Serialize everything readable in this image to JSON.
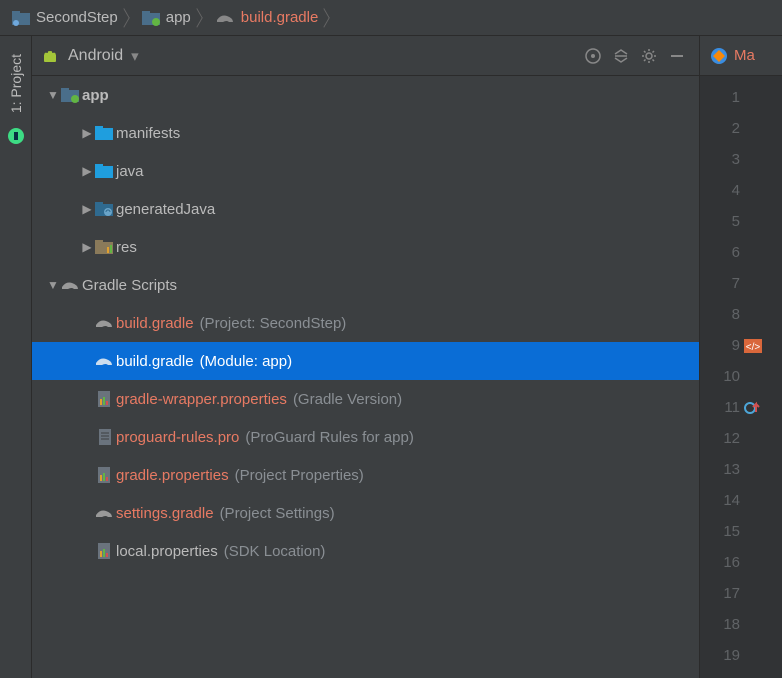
{
  "breadcrumb": [
    {
      "label": "SecondStep",
      "active": false,
      "icon": "project"
    },
    {
      "label": "app",
      "active": false,
      "icon": "module"
    },
    {
      "label": "build.gradle",
      "active": true,
      "icon": "gradle"
    }
  ],
  "rail": {
    "label": "1: Project"
  },
  "panel": {
    "title": "Android",
    "actions": [
      "target",
      "collapse",
      "settings",
      "hide"
    ]
  },
  "tree": [
    {
      "depth": 0,
      "twisty": "down",
      "icon": "module",
      "name": "app",
      "bold": true
    },
    {
      "depth": 1,
      "twisty": "right",
      "icon": "folder",
      "name": "manifests"
    },
    {
      "depth": 1,
      "twisty": "right",
      "icon": "folder",
      "name": "java"
    },
    {
      "depth": 1,
      "twisty": "right",
      "icon": "genfolder",
      "name": "generatedJava"
    },
    {
      "depth": 1,
      "twisty": "right",
      "icon": "resfolder",
      "name": "res"
    },
    {
      "depth": 0,
      "twisty": "down",
      "icon": "gradle",
      "name": "Gradle Scripts"
    },
    {
      "depth": 1,
      "twisty": "",
      "icon": "gradle",
      "name": "build.gradle",
      "orange": true,
      "hint": "(Project: SecondStep)"
    },
    {
      "depth": 1,
      "twisty": "",
      "icon": "gradle",
      "name": "build.gradle",
      "hint": "(Module: app)",
      "selected": true
    },
    {
      "depth": 1,
      "twisty": "",
      "icon": "props",
      "name": "gradle-wrapper.properties",
      "orange": true,
      "hint": "(Gradle Version)"
    },
    {
      "depth": 1,
      "twisty": "",
      "icon": "file",
      "name": "proguard-rules.pro",
      "orange": true,
      "hint": "(ProGuard Rules for app)"
    },
    {
      "depth": 1,
      "twisty": "",
      "icon": "props",
      "name": "gradle.properties",
      "orange": true,
      "hint": "(Project Properties)"
    },
    {
      "depth": 1,
      "twisty": "",
      "icon": "gradle",
      "name": "settings.gradle",
      "orange": true,
      "hint": "(Project Settings)"
    },
    {
      "depth": 1,
      "twisty": "",
      "icon": "props",
      "name": "local.properties",
      "hint": "(SDK Location)"
    }
  ],
  "editor": {
    "tab_label": "Ma",
    "lines": 19,
    "markers": {
      "9": "xml",
      "11": "override"
    }
  }
}
